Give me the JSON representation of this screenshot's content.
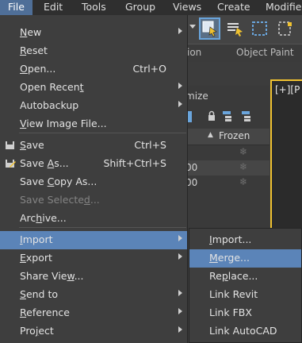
{
  "menubar": {
    "items": [
      {
        "label": "File",
        "active": true
      },
      {
        "label": "Edit"
      },
      {
        "label": "Tools"
      },
      {
        "label": "Group"
      },
      {
        "label": "Views"
      },
      {
        "label": "Create"
      },
      {
        "label": "Modifiers"
      }
    ]
  },
  "ribbon": {
    "tab_partial": "ion",
    "object_paint": "Object Paint"
  },
  "viewport": {
    "label": "[+][P"
  },
  "scene_explorer": {
    "label_partial": "mize",
    "column_frozen": "Frozen",
    "rows": [
      {
        "value": ""
      },
      {
        "value": "00"
      },
      {
        "value": "00"
      }
    ]
  },
  "file_menu": {
    "items": [
      {
        "label": "New",
        "u": "N",
        "submenu": true
      },
      {
        "label": "Reset",
        "u": "R"
      },
      {
        "label": "Open...",
        "u": "O",
        "shortcut": "Ctrl+O"
      },
      {
        "label": "Open Recent",
        "u": "t",
        "submenu": true
      },
      {
        "label": "Autobackup",
        "submenu": true
      },
      {
        "label": "View Image File...",
        "u": "V"
      },
      {
        "label": "Save",
        "u": "S",
        "shortcut": "Ctrl+S",
        "icon": "save-icon"
      },
      {
        "label": "Save As...",
        "u": "A",
        "shortcut": "Shift+Ctrl+S",
        "icon": "save-as-icon"
      },
      {
        "label": "Save Copy As...",
        "u": "C"
      },
      {
        "label": "Save Selected...",
        "u": "d",
        "disabled": true
      },
      {
        "label": "Archive...",
        "u": "h"
      },
      {
        "label": "Import",
        "u": "I",
        "submenu": true,
        "highlighted": true
      },
      {
        "label": "Export",
        "u": "E",
        "submenu": true
      },
      {
        "label": "Share View...",
        "u": "w"
      },
      {
        "label": "Send to",
        "u": "S",
        "submenu": true
      },
      {
        "label": "Reference",
        "u": "R",
        "submenu": true
      },
      {
        "label": "Project",
        "u": "j",
        "submenu": true
      }
    ]
  },
  "import_submenu": {
    "items": [
      {
        "label": "Import...",
        "u": "I"
      },
      {
        "label": "Merge...",
        "u": "M",
        "highlighted": true
      },
      {
        "label": "Replace...",
        "u": "p"
      },
      {
        "label": "Link Revit"
      },
      {
        "label": "Link FBX"
      },
      {
        "label": "Link AutoCAD"
      }
    ]
  },
  "colors": {
    "menu_bg": "#3e3e3e",
    "highlight": "#5b84b8",
    "menubar_active": "#4f6f98",
    "viewport_border": "#f0c230"
  }
}
